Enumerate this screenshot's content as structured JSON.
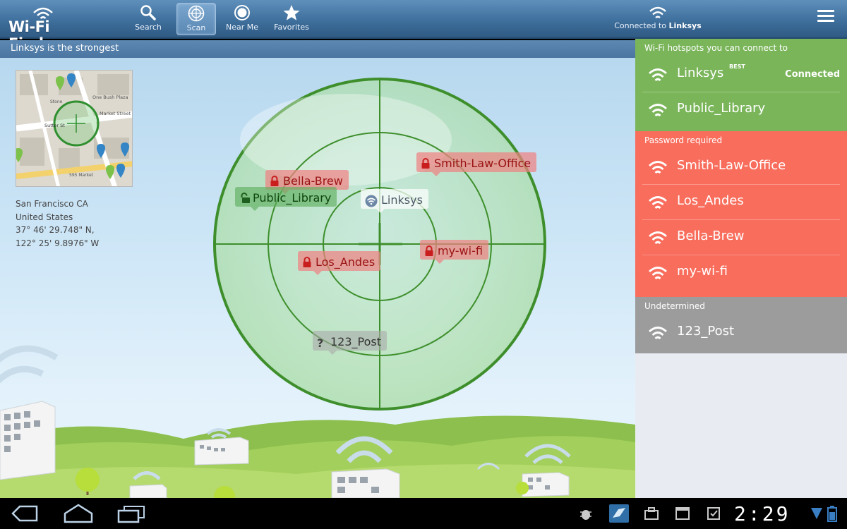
{
  "app": {
    "title": "Wi-Fi Finder"
  },
  "nav": [
    {
      "label": "Search",
      "icon": "search-icon"
    },
    {
      "label": "Scan",
      "icon": "scan-icon",
      "active": true
    },
    {
      "label": "Near Me",
      "icon": "near-me-icon"
    },
    {
      "label": "Favorites",
      "icon": "star-icon"
    }
  ],
  "connection": {
    "prefix": "Connected to",
    "network": "Linksys"
  },
  "status_message": "Linksys is the strongest",
  "location": {
    "city": "San Francisco CA",
    "country": "United States",
    "lat": "37° 46' 29.748\" N,",
    "lon": "122° 25' 9.8976\" W"
  },
  "map": {
    "labels": [
      "One Bush Plaza",
      "Market Street Plaza",
      "Sutter St",
      "595 Market",
      "Stone"
    ]
  },
  "radar_tags": [
    {
      "name": "Smith-Law-Office",
      "status": "locked"
    },
    {
      "name": "Bella-Brew",
      "status": "locked"
    },
    {
      "name": "Public_Library",
      "status": "open"
    },
    {
      "name": "Linksys",
      "status": "connected"
    },
    {
      "name": "my-wi-fi",
      "status": "locked"
    },
    {
      "name": "Los_Andes",
      "status": "locked"
    },
    {
      "name": "123_Post",
      "status": "unknown"
    }
  ],
  "panel": {
    "connectable": {
      "heading": "Wi-Fi hotspots you can connect to",
      "color": "#7ab55a",
      "items": [
        {
          "name": "Linksys",
          "badge": "BEST",
          "state": "Connected"
        },
        {
          "name": "Public_Library"
        }
      ]
    },
    "password": {
      "heading": "Password required",
      "color": "#f96d5c",
      "items": [
        {
          "name": "Smith-Law-Office"
        },
        {
          "name": "Los_Andes"
        },
        {
          "name": "Bella-Brew"
        },
        {
          "name": "my-wi-fi"
        }
      ]
    },
    "undetermined": {
      "heading": "Undetermined",
      "color": "#9c9c9c",
      "items": [
        {
          "name": "123_Post"
        }
      ]
    }
  },
  "system": {
    "clock": "2:29"
  }
}
